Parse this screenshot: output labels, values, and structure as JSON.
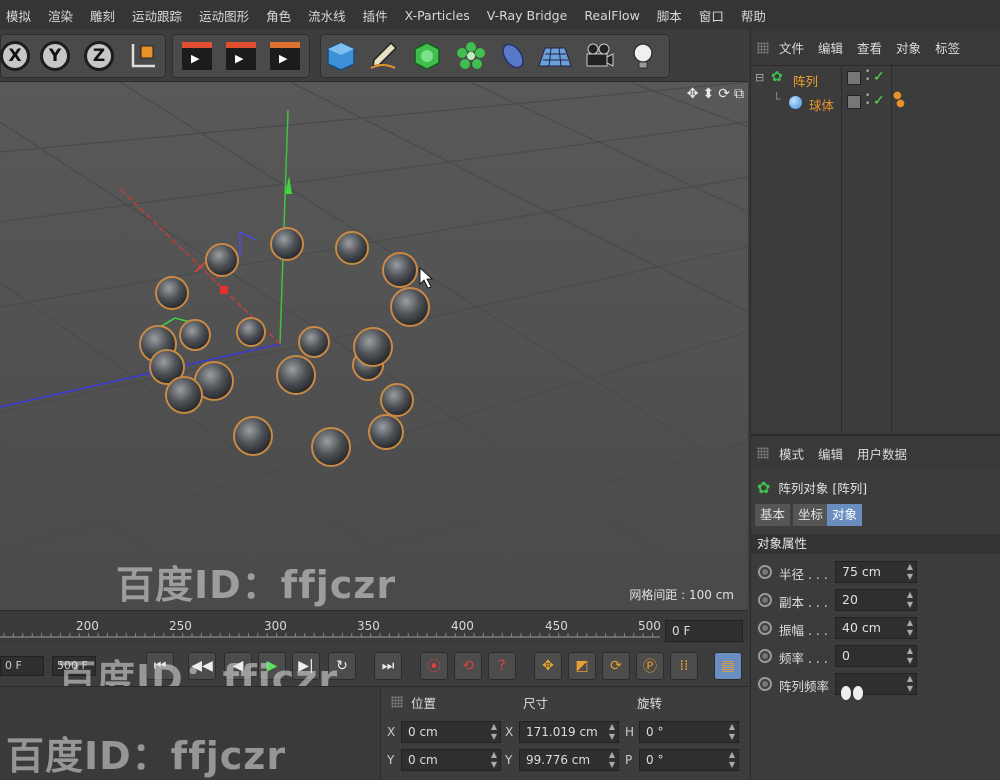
{
  "menubar": {
    "items": [
      "模拟",
      "渲染",
      "雕刻",
      "运动跟踪",
      "运动图形",
      "角色",
      "流水线",
      "插件",
      "X-Particles",
      "V-Ray Bridge",
      "RealFlow",
      "脚本",
      "窗口",
      "帮助"
    ]
  },
  "toolbar": {
    "axis_x": "X",
    "axis_y": "Y",
    "axis_z": "Z"
  },
  "viewport": {
    "grid_spacing": "网格间距 : 100 cm",
    "watermark": "百度ID：ffjczr"
  },
  "timeline": {
    "ticks": [
      "200",
      "250",
      "300",
      "350",
      "400",
      "450",
      "500"
    ],
    "current_frame": "0 F",
    "start_field": "0 F",
    "end_field": "500 F"
  },
  "coordinates": {
    "headers": {
      "position": "位置",
      "size": "尺寸",
      "rotation": "旋转"
    },
    "row1": {
      "axis_p": "X",
      "pos": "0 cm",
      "axis_s": "X",
      "size": "171.019 cm",
      "axis_r": "H",
      "rot": "0 °"
    },
    "row2": {
      "axis_p": "Y",
      "pos": "0 cm",
      "axis_s": "Y",
      "size": "99.776 cm",
      "axis_r": "P",
      "rot": "0 °"
    }
  },
  "object_manager": {
    "menu": [
      "文件",
      "编辑",
      "查看",
      "对象",
      "标签"
    ],
    "objects": [
      {
        "name": "阵列",
        "level": 0
      },
      {
        "name": "球体",
        "level": 1
      }
    ]
  },
  "attribute_manager": {
    "menu": [
      "模式",
      "编辑",
      "用户数据"
    ],
    "object_title": "阵列对象 [阵列]",
    "tabs": [
      "基本",
      "坐标",
      "对象"
    ],
    "active_tab": "对象",
    "section": "对象属性",
    "properties": [
      {
        "label": "半径 . . .",
        "value": "75 cm"
      },
      {
        "label": "副本 . . .",
        "value": "20"
      },
      {
        "label": "振幅 . . .",
        "value": "40 cm"
      },
      {
        "label": "频率 . . .",
        "value": "0"
      },
      {
        "label": "阵列频率",
        "value": ""
      }
    ]
  },
  "colors": {
    "accent_blue": "#6b8ec0",
    "orange_highlight": "#e8a030",
    "selection_outline": "#d08a3a"
  }
}
